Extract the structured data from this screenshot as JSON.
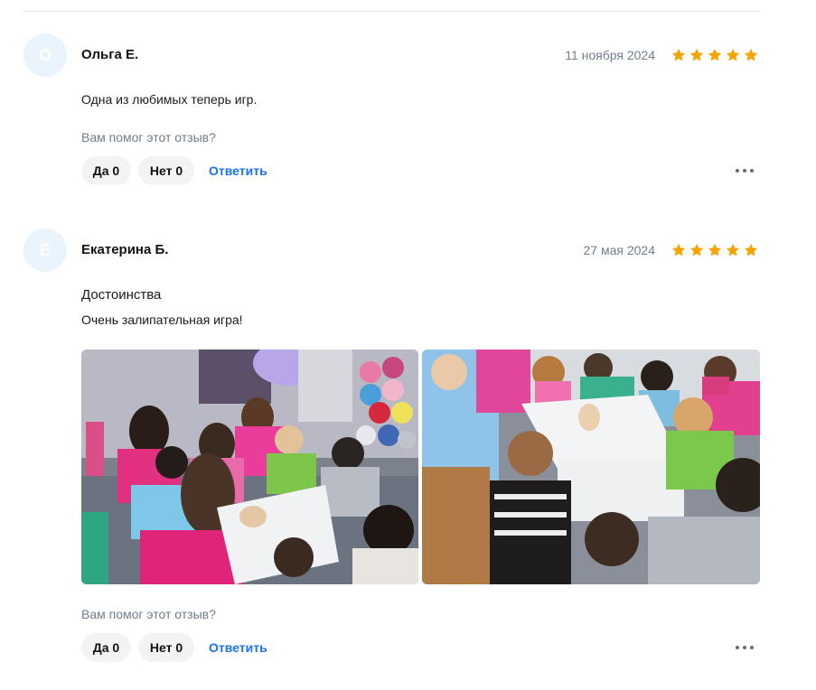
{
  "reviews": [
    {
      "avatar_letter": "О",
      "author": "Ольга Е.",
      "date": "11 ноября 2024",
      "rating": 5,
      "text": "Одна из любимых теперь игр.",
      "helpful_question": "Вам помог этот отзыв?",
      "yes_label": "Да 0",
      "no_label": "Нет 0",
      "reply_label": "Ответить"
    },
    {
      "avatar_letter": "Е",
      "author": "Екатерина Б.",
      "date": "27 мая 2024",
      "rating": 5,
      "section_title": "Достоинства",
      "text": "Очень залипательная игра!",
      "photos": [
        "review-photo-1",
        "review-photo-2"
      ],
      "helpful_question": "Вам помог этот отзыв?",
      "yes_label": "Да 0",
      "no_label": "Нет 0",
      "reply_label": "Ответить"
    }
  ],
  "colors": {
    "star": "#f5a300",
    "link": "#1a73e8",
    "muted": "#6f7d8c",
    "button_bg": "#f2f3f5",
    "avatar_bg": "#eaf4fd"
  },
  "icons": [
    "star-icon",
    "more-dots-icon"
  ]
}
